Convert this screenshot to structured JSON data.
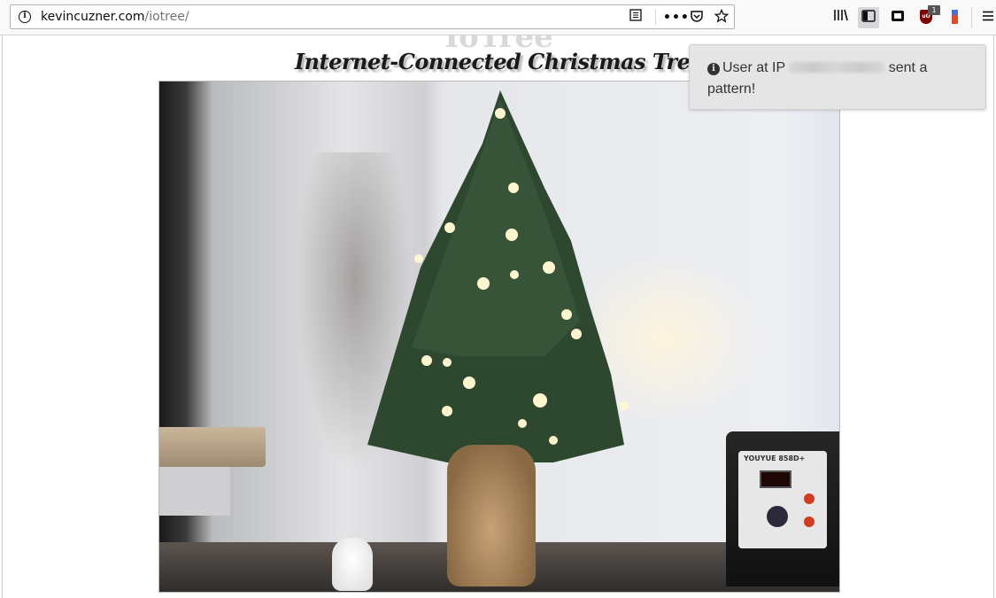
{
  "browser": {
    "url_host": "kevincuzner.com",
    "url_path": "/iotree/",
    "icons": [
      "info-icon",
      "reader-view-icon",
      "page-actions-icon",
      "pocket-icon",
      "bookmark-star-icon",
      "library-icon",
      "sidebar-icon",
      "synced-tabs-icon",
      "ublock-icon",
      "extension-icon",
      "hamburger-menu-icon"
    ],
    "ublock_badge": "1"
  },
  "page": {
    "ghost_title": "IoTree",
    "title": "Internet-Connected Christmas Tree",
    "camera_alt": "webcam view of christmas tree"
  },
  "station": {
    "brand": "YOUYUE 858D+"
  },
  "notification": {
    "icon": "info-icon",
    "text_before": "User at IP",
    "text_after": "sent a pattern!"
  },
  "colors": {
    "toolbar_bg": "#f9f9fa",
    "notification_bg": "#e5e5e5",
    "tree_green": "#2f4a32",
    "light_warm": "#fff6cf"
  }
}
